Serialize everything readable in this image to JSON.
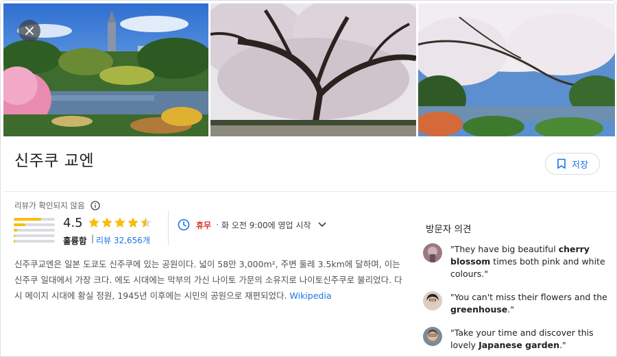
{
  "place": {
    "title": "신주쿠 교엔",
    "save_label": "저장"
  },
  "reviews": {
    "unverified_label": "리뷰가 확인되지 않음",
    "rating": "4.5",
    "rating_value": 4.5,
    "rating_label": "훌륭함",
    "separator": "|",
    "review_count_label": "리뷰 32,656개",
    "distribution": [
      {
        "stars": 5,
        "fraction": 0.66
      },
      {
        "stars": 4,
        "fraction": 0.28
      },
      {
        "stars": 3,
        "fraction": 0.08
      },
      {
        "stars": 2,
        "fraction": 0.03
      },
      {
        "stars": 1,
        "fraction": 0.03
      }
    ]
  },
  "hours": {
    "status": "휴무",
    "separator": "·",
    "next_open": "화 오전 9:00에 영업 시작"
  },
  "description": {
    "text": "신주쿠교엔은 일본 도쿄도 신주쿠에 있는 공원이다. 넓이 58만 3,000m², 주변 둘레 3.5km에 달하며, 이는 신주쿠 일대에서 가장 크다. 에도 시대에는 막부의 가신 나이토 가문의 소유지로 나이토신주쿠로 불리었다. 다시 메이지 시대에 황실 정원, 1945년 이후에는 시민의 공원으로 재편되었다.",
    "source_link": "Wikipedia"
  },
  "opinions": {
    "title": "방문자 의견",
    "items": [
      {
        "pre": "\"They have big beautiful ",
        "bold": "cherry blossom",
        "post": " times both pink and white colours.\""
      },
      {
        "pre": "\"You can't miss their flowers and the ",
        "bold": "greenhouse",
        "post": ".\""
      },
      {
        "pre": "\"Take your time and discover this lovely ",
        "bold": "Japanese garden",
        "post": ".\""
      }
    ]
  },
  "colors": {
    "accent_blue": "#1a73e8",
    "star_yellow": "#fbbc04",
    "closed_red": "#d93025"
  },
  "icons": [
    "close-icon",
    "bookmark-icon",
    "info-icon",
    "star-icon",
    "clock-icon",
    "chevron-down-icon"
  ]
}
